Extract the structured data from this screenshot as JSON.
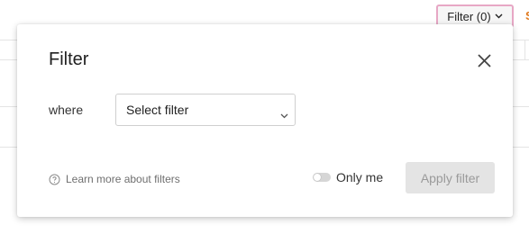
{
  "toolbar": {
    "filter_button_label": "Filter (0)",
    "edge_letter": "S"
  },
  "dialog": {
    "title": "Filter",
    "where_label": "where",
    "select": {
      "value": "Select filter"
    },
    "help_link_label": "Learn more about filters",
    "only_me_label": "Only me",
    "only_me_enabled": false,
    "apply_button_label": "Apply filter",
    "apply_button_enabled": false
  },
  "icons": {
    "close": "close-icon",
    "chevron": "chevron-down-icon",
    "help": "help-circle-icon",
    "toggle": "toggle-switch"
  },
  "colors": {
    "filter_button_border": "#e7a7c5",
    "edge_letter": "#e07a1f",
    "apply_disabled_bg": "#e4e4e4",
    "apply_disabled_text": "#9a9a9a"
  }
}
